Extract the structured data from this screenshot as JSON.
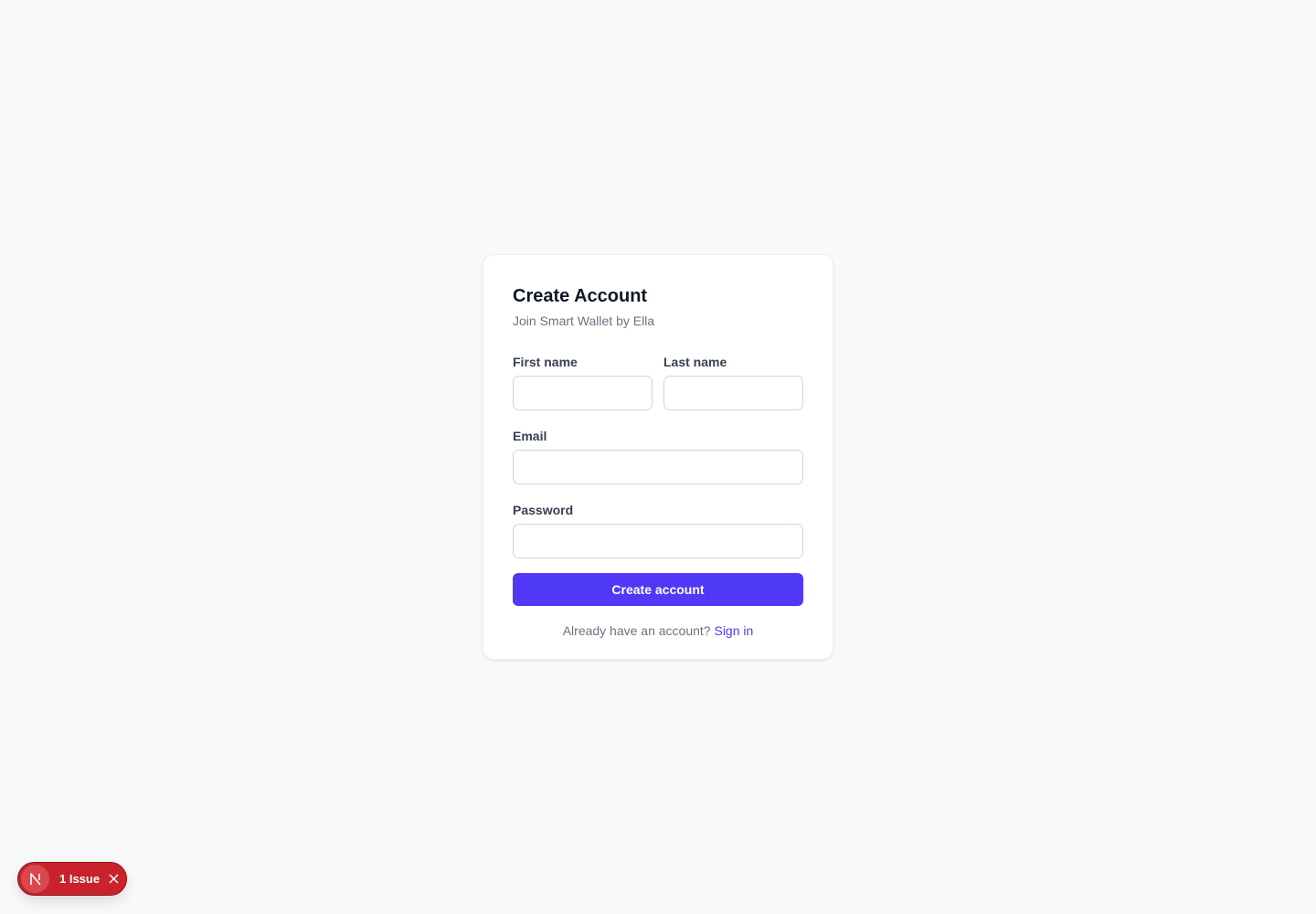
{
  "card": {
    "title": "Create Account",
    "subtitle": "Join Smart Wallet by Ella"
  },
  "form": {
    "first_name_label": "First name",
    "first_name_value": "",
    "last_name_label": "Last name",
    "last_name_value": "",
    "email_label": "Email",
    "email_value": "",
    "password_label": "Password",
    "password_value": "",
    "submit_label": "Create account"
  },
  "footer": {
    "prompt": "Already have an account?",
    "link_label": "Sign in"
  },
  "dev_indicator": {
    "logo_letter": "N",
    "issue_label": "1 Issue",
    "icons": [
      "next-logo-icon",
      "close-icon"
    ]
  },
  "colors": {
    "page_background": "#f8f9fb",
    "accent": "#4f39f6",
    "issue_red": "#c8232c"
  }
}
